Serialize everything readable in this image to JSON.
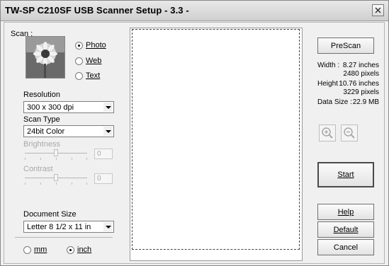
{
  "window": {
    "title": "TW-SP C210SF USB Scanner Setup - 3.3 -"
  },
  "scan": {
    "label": "Scan :",
    "options": [
      {
        "label": "Photo",
        "selected": true
      },
      {
        "label": "Web",
        "selected": false
      },
      {
        "label": "Text",
        "selected": false
      }
    ]
  },
  "resolution": {
    "label": "Resolution",
    "value": "300 x 300 dpi"
  },
  "scan_type": {
    "label": "Scan Type",
    "value": "24bit Color"
  },
  "brightness": {
    "label": "Brightness",
    "value": "0"
  },
  "contrast": {
    "label": "Contrast",
    "value": "0"
  },
  "document_size": {
    "label": "Document Size",
    "value": "Letter 8 1/2 x 11 in"
  },
  "units": [
    {
      "label": "mm",
      "selected": false
    },
    {
      "label": "inch",
      "selected": true
    }
  ],
  "buttons": {
    "prescan": "PreScan",
    "start": "Start",
    "help": "Help",
    "default": "Default",
    "cancel": "Cancel"
  },
  "info": {
    "width_label": "Width :",
    "width_in": "8.27 inches",
    "width_px": "2480 pixels",
    "height_label": "Height :",
    "height_in": "10.76 inches",
    "height_px": "3229 pixels",
    "size_label": "Data Size :",
    "size_val": "22.9 MB"
  },
  "icons": {
    "close": "close-icon",
    "zoom_in": "zoom-in-icon",
    "zoom_out": "zoom-out-icon",
    "photo": "sunflower-photo-icon"
  }
}
